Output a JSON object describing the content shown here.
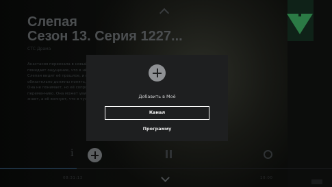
{
  "program": {
    "title_line1": "Слепая",
    "title_line2": "Сезон 13. Серия 1227...",
    "meta": "СТС  Драма",
    "description": "Анастасия переехала в новый дом, но её не покидает ощущение, что в нём кто-то есть. Слепая видит её прошлое, и как новые хозяйки обязательно должны понять, что это не случайно. Она не понимает, но её сопровождает человек переменчиво. Она может увидеть то, о чём не знает, а её волнует, что в чужом доме..."
  },
  "player": {
    "time_start": "08:31:13",
    "time_end": "10:00",
    "progress": 0.23
  },
  "modal": {
    "heading": "Добавить в Моё",
    "button_channel": "Канал",
    "button_program": "Программу"
  },
  "colors": {
    "logo_green": "#2b7a45",
    "modal_bg": "#1e1f20",
    "focus_border": "#ffffff"
  },
  "icons": [
    "chevron-up-icon",
    "info-icon",
    "plus-icon",
    "pause-icon",
    "settings-icon",
    "chevron-down-icon",
    "channel-logo-icon"
  ]
}
